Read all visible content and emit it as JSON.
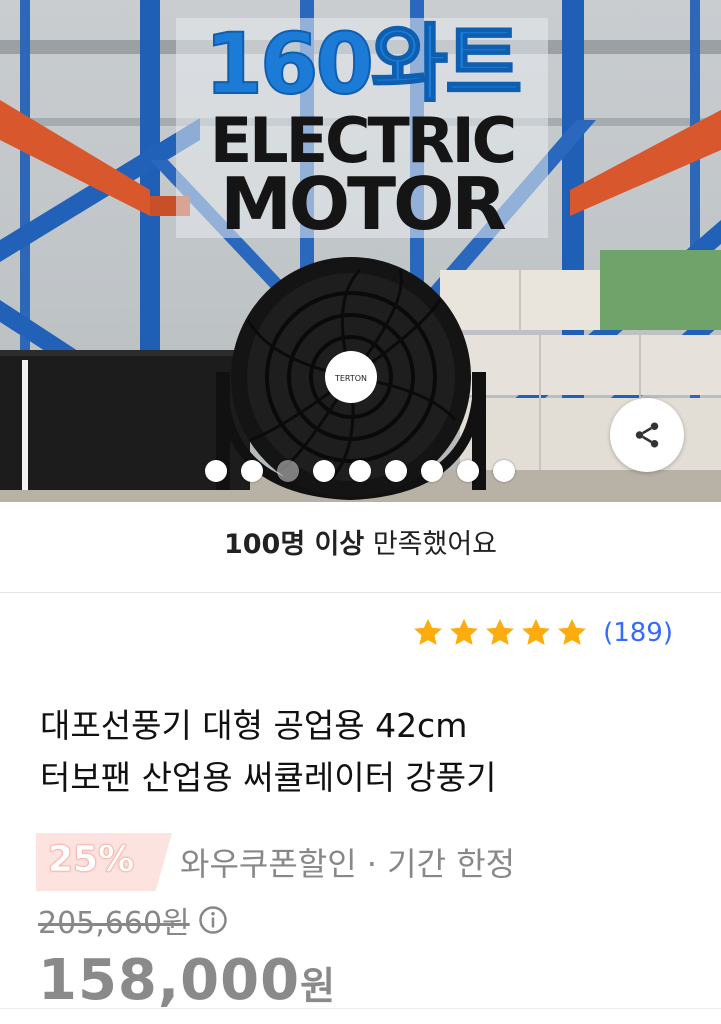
{
  "hero": {
    "banner_line1": "160와트",
    "banner_line2": "ELECTRIC",
    "banner_line3": "MOTOR",
    "fan_brand": "TERTON",
    "slide_count": 9,
    "active_slide": 3,
    "share_icon": "share-icon"
  },
  "satisfaction": {
    "count": "100명 이상",
    "text": " 만족했어요"
  },
  "rating": {
    "stars": 5,
    "review_count": "(189)",
    "star_color": "#fcad0d",
    "link_color": "#346aff"
  },
  "product": {
    "title_line1": "대포선풍기 대형 공업용 42cm",
    "title_line2": "터보팬 산업용 써큘레이터 강풍기"
  },
  "pricing": {
    "discount_rate": "25%",
    "discount_label": "와우쿠폰할인 · 기간 한정",
    "original_price": "205,660원",
    "sale_price_number": "158,000",
    "sale_price_unit": "원",
    "info_icon": "info-icon"
  }
}
